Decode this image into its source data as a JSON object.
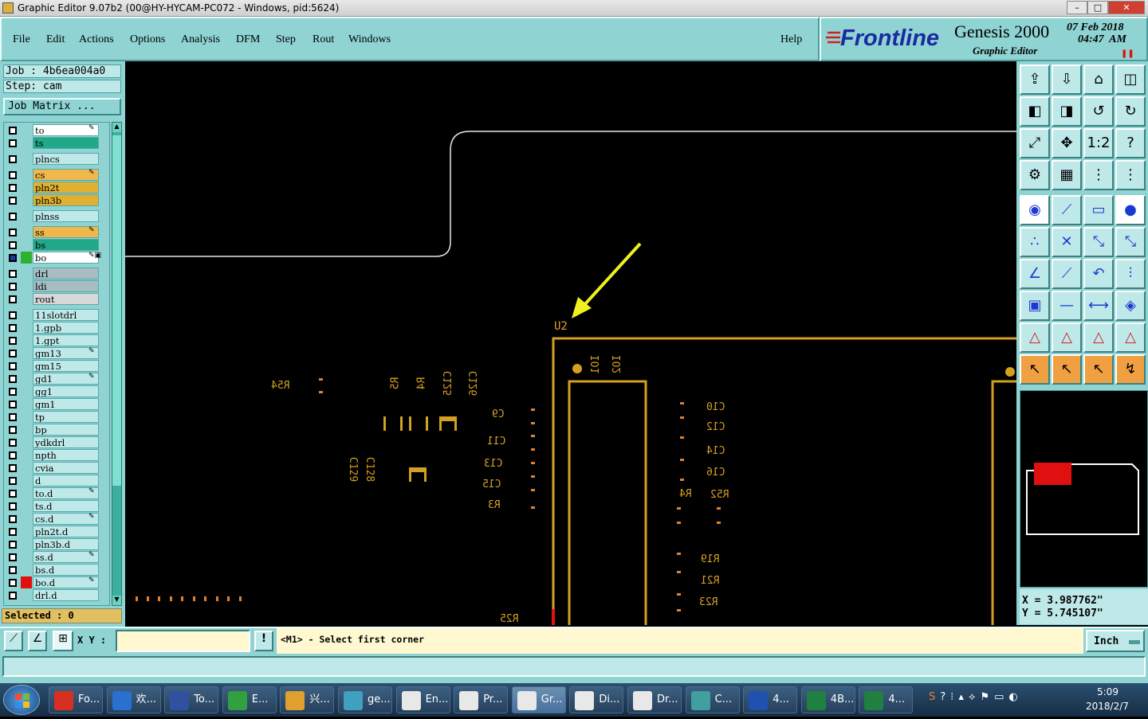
{
  "window": {
    "title": "Graphic Editor 9.07b2 (00@HY-HYCAM-PC072 - Windows, pid:5624)",
    "controls": [
      "–",
      "□",
      "✕"
    ]
  },
  "menu": {
    "items": [
      "File",
      "Edit",
      "Actions",
      "Options",
      "Analysis",
      "DFM",
      "Step",
      "Rout",
      "Windows"
    ],
    "help": "Help"
  },
  "brand": {
    "logo": "Frontline",
    "product": "Genesis 2000",
    "subtitle": "Graphic Editor",
    "date": "07 Feb 2018",
    "time": "04:47  AM"
  },
  "job": {
    "job_label": "Job : 4b6ea004a0",
    "step_label": "Step: cam",
    "matrix_button": "Job Matrix ..."
  },
  "layers": [
    {
      "name": "to",
      "color": "#ffffff",
      "mark": "✎"
    },
    {
      "name": "ts",
      "color": "#20a888",
      "mark": ""
    },
    {
      "name": "plncs",
      "color": "#bfe9e9",
      "mark": ""
    },
    {
      "name": "cs",
      "color": "#f0b84c",
      "mark": "✎"
    },
    {
      "name": "pln2t",
      "color": "#e0b030",
      "mark": ""
    },
    {
      "name": "pln3b",
      "color": "#e0b030",
      "mark": ""
    },
    {
      "name": "plnss",
      "color": "#bfe9e9",
      "mark": ""
    },
    {
      "name": "ss",
      "color": "#f0b84c",
      "mark": "✎"
    },
    {
      "name": "bs",
      "color": "#20a888",
      "mark": ""
    },
    {
      "name": "bo",
      "color": "#ffffff",
      "mark": "✎▣"
    },
    {
      "name": "drl",
      "color": "#a8bcc4",
      "mark": ""
    },
    {
      "name": "ldi",
      "color": "#a8bcc4",
      "mark": ""
    },
    {
      "name": "rout",
      "color": "#d8d8d8",
      "mark": ""
    },
    {
      "name": "11slotdrl",
      "color": "#bfe9e9",
      "mark": ""
    },
    {
      "name": "1.gpb",
      "color": "#bfe9e9",
      "mark": ""
    },
    {
      "name": "1.gpt",
      "color": "#bfe9e9",
      "mark": ""
    },
    {
      "name": "gm13",
      "color": "#bfe9e9",
      "mark": "✎"
    },
    {
      "name": "gm15",
      "color": "#bfe9e9",
      "mark": ""
    },
    {
      "name": "gd1",
      "color": "#bfe9e9",
      "mark": "✎"
    },
    {
      "name": "gg1",
      "color": "#bfe9e9",
      "mark": ""
    },
    {
      "name": "gm1",
      "color": "#bfe9e9",
      "mark": ""
    },
    {
      "name": "tp",
      "color": "#bfe9e9",
      "mark": ""
    },
    {
      "name": "bp",
      "color": "#bfe9e9",
      "mark": ""
    },
    {
      "name": "ydkdrl",
      "color": "#bfe9e9",
      "mark": ""
    },
    {
      "name": "npth",
      "color": "#bfe9e9",
      "mark": ""
    },
    {
      "name": "cvia",
      "color": "#bfe9e9",
      "mark": ""
    },
    {
      "name": "d",
      "color": "#bfe9e9",
      "mark": ""
    },
    {
      "name": "to.d",
      "color": "#bfe9e9",
      "mark": "✎"
    },
    {
      "name": "ts.d",
      "color": "#bfe9e9",
      "mark": ""
    },
    {
      "name": "cs.d",
      "color": "#bfe9e9",
      "mark": "✎"
    },
    {
      "name": "pln2t.d",
      "color": "#bfe9e9",
      "mark": ""
    },
    {
      "name": "pln3b.d",
      "color": "#bfe9e9",
      "mark": ""
    },
    {
      "name": "ss.d",
      "color": "#bfe9e9",
      "mark": "✎"
    },
    {
      "name": "bs.d",
      "color": "#bfe9e9",
      "mark": ""
    },
    {
      "name": "bo.d",
      "color": "#bfe9e9",
      "mark": "✎"
    },
    {
      "name": "drl.d",
      "color": "#bfe9e9",
      "mark": ""
    }
  ],
  "selected": "Selected : 0",
  "canvas_labels": {
    "u2": "U2",
    "refs": [
      "R54",
      "R5",
      "R4",
      "C125",
      "C126",
      "C9",
      "C11",
      "C13",
      "C15",
      "R3",
      "C129",
      "C128",
      "IO1",
      "IO2",
      "C10",
      "C12",
      "C14",
      "C16",
      "R4",
      "R52",
      "R19",
      "R21",
      "R23",
      "R25"
    ]
  },
  "toolbar_icons": [
    "open-job-icon",
    "save-icon",
    "home-icon",
    "window-icon",
    "prev-step-icon",
    "next-step-icon",
    "swap-icon",
    "redraw-icon",
    "zoom-fit-icon",
    "zoom-center-icon",
    "zoom-one-icon",
    "help-icon",
    "settings-icon",
    "grid-icon",
    "layer-toggle-icon",
    "layer-toggle-red-icon",
    "snap-pad-icon",
    "snap-diag-icon",
    "ruler-icon",
    "target-icon",
    "snap-node-icon",
    "snap-cross-icon",
    "snap-point-icon",
    "snap-red-icon",
    "line-icon",
    "line-red-icon",
    "arc-icon",
    "mirror-icon",
    "select-point-icon",
    "hline-icon",
    "measure-icon",
    "shape-icon",
    "triangle-icon",
    "triangle-a-icon",
    "triangle-b-icon",
    "triangle-c-icon",
    "pointer-icon",
    "pointer-box-icon",
    "pointer-circle-icon",
    "route-icon"
  ],
  "coords": {
    "x": "X = 3.987762\"",
    "y": "Y = 5.745107\""
  },
  "command": {
    "xy_label": "X Y :",
    "xy_value": "",
    "prompt": "<M1> - Select first corner",
    "unit": "Inch"
  },
  "taskbar": {
    "items": [
      "Fo...",
      "欢...",
      "To...",
      "E...",
      "兴...",
      "ge...",
      "En...",
      "Pr...",
      "Gr...",
      "Di...",
      "Dr...",
      "C...",
      "4...",
      "4B...",
      "4..."
    ],
    "clock_time": "5:09",
    "clock_date": "2018/2/7"
  }
}
